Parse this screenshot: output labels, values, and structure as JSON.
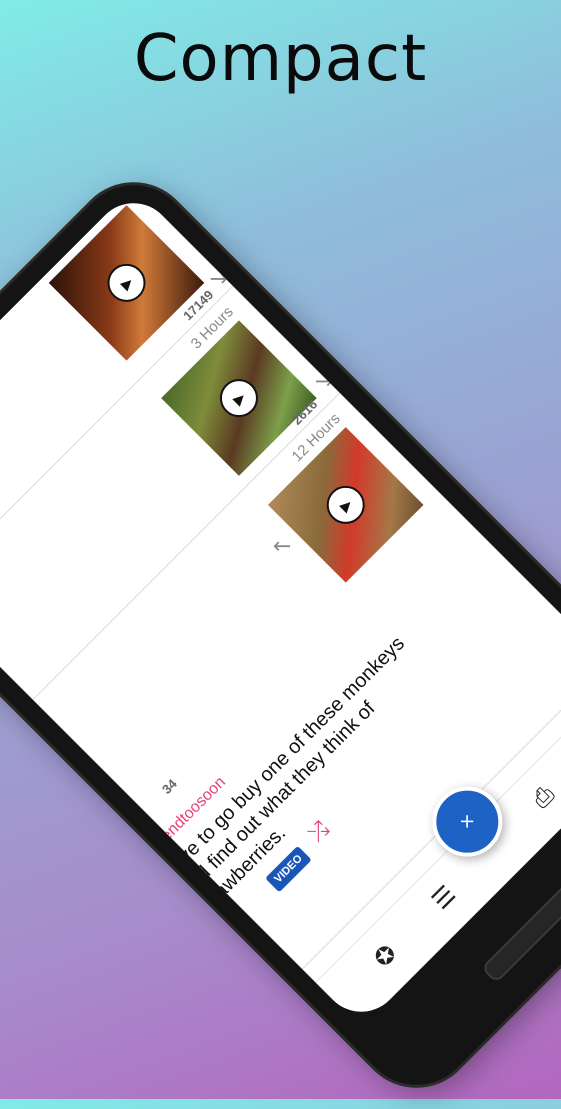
{
  "headline": "Compact",
  "feed": {
    "posts": [
      {
        "time": "",
        "count": "17149"
      },
      {
        "time": "3 Hours",
        "count": "2616"
      },
      {
        "time": "12 Hours",
        "count": "34",
        "subreddit": "natendtoosoon",
        "title": "have to go buy one of these monkeys and find out what they think of strawberries.",
        "badge": "VIDEO"
      }
    ]
  },
  "nav": {
    "icons": [
      "star-icon",
      "posts-icon",
      "inbox-icon",
      "profile-icon"
    ],
    "fab_label": "×"
  },
  "colors": {
    "accent": "#1d62c4",
    "subreddit": "#e4407a"
  }
}
